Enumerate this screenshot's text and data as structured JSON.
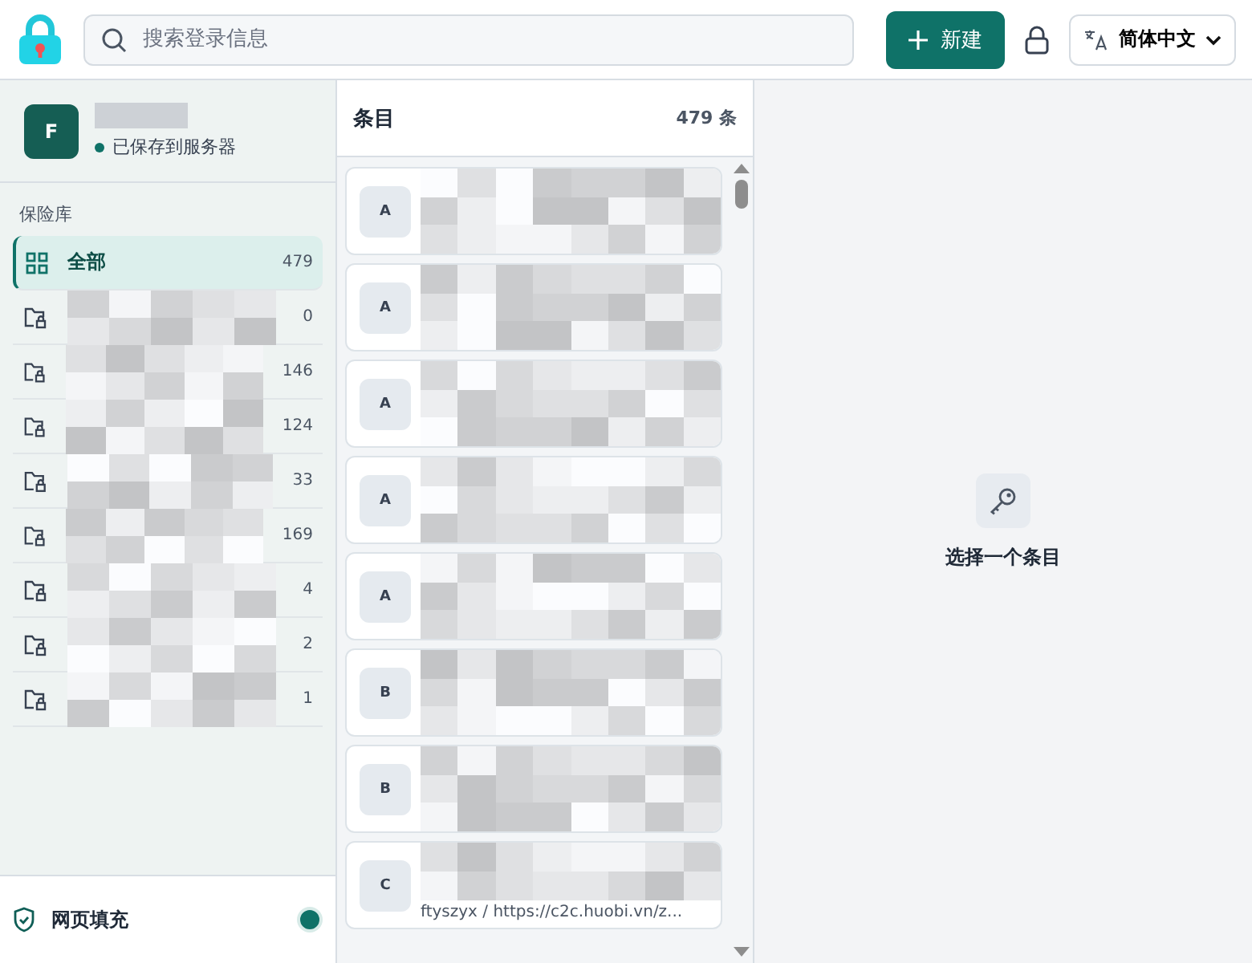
{
  "header": {
    "search": {
      "placeholder": "搜索登录信息"
    },
    "new_button": "新建",
    "language": "简体中文"
  },
  "sidebar": {
    "profile": {
      "initial": "F",
      "status": "已保存到服务器"
    },
    "section_label": "保险库",
    "items": [
      {
        "kind": "all",
        "label": "全部",
        "count": "479",
        "selected": true
      },
      {
        "kind": "folder",
        "count": "0",
        "selected": false
      },
      {
        "kind": "folder",
        "count": "146",
        "selected": false
      },
      {
        "kind": "folder",
        "count": "124",
        "selected": false
      },
      {
        "kind": "folder",
        "count": "33",
        "selected": false
      },
      {
        "kind": "folder",
        "count": "169",
        "selected": false
      },
      {
        "kind": "folder",
        "count": "4",
        "selected": false
      },
      {
        "kind": "folder",
        "count": "2",
        "selected": false
      },
      {
        "kind": "folder",
        "count": "1",
        "selected": false
      }
    ],
    "autofill": {
      "label": "网页填充",
      "on": true
    }
  },
  "list": {
    "title": "条目",
    "count": "479 条",
    "entries": [
      {
        "badge": "A"
      },
      {
        "badge": "A"
      },
      {
        "badge": "A"
      },
      {
        "badge": "A"
      },
      {
        "badge": "A"
      },
      {
        "badge": "B"
      },
      {
        "badge": "B"
      },
      {
        "badge": "C",
        "subtitle": "ftyszyx / https://c2c.huobi.vn/z..."
      }
    ]
  },
  "detail": {
    "empty_text": "选择一个条目"
  }
}
